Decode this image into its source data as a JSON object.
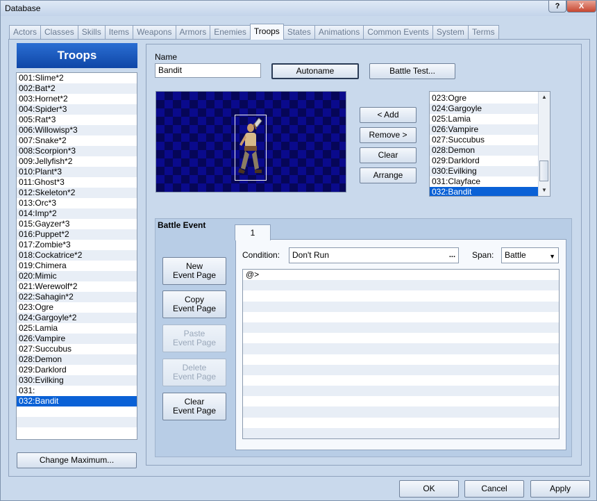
{
  "window": {
    "title": "Database",
    "help_label": "?",
    "close_label": "X"
  },
  "tabs": [
    {
      "label": "Actors"
    },
    {
      "label": "Classes"
    },
    {
      "label": "Skills"
    },
    {
      "label": "Items"
    },
    {
      "label": "Weapons"
    },
    {
      "label": "Armors"
    },
    {
      "label": "Enemies"
    },
    {
      "label": "Troops"
    },
    {
      "label": "States"
    },
    {
      "label": "Animations"
    },
    {
      "label": "Common Events"
    },
    {
      "label": "System"
    },
    {
      "label": "Terms"
    }
  ],
  "active_tab": "Troops",
  "troops": {
    "header": "Troops",
    "items": [
      "001:Slime*2",
      "002:Bat*2",
      "003:Hornet*2",
      "004:Spider*3",
      "005:Rat*3",
      "006:Willowisp*3",
      "007:Snake*2",
      "008:Scorpion*3",
      "009:Jellyfish*2",
      "010:Plant*3",
      "011:Ghost*3",
      "012:Skeleton*2",
      "013:Orc*3",
      "014:Imp*2",
      "015:Gayzer*3",
      "016:Puppet*2",
      "017:Zombie*3",
      "018:Cockatrice*2",
      "019:Chimera",
      "020:Mimic",
      "021:Werewolf*2",
      "022:Sahagin*2",
      "023:Ogre",
      "024:Gargoyle*2",
      "025:Lamia",
      "026:Vampire",
      "027:Succubus",
      "028:Demon",
      "029:Darklord",
      "030:Evilking",
      "031:",
      "032:Bandit"
    ],
    "selected": "032:Bandit",
    "change_max_label": "Change Maximum..."
  },
  "editor": {
    "name_label": "Name",
    "name_value": "Bandit",
    "autoname_label": "Autoname",
    "battle_test_label": "Battle Test...",
    "add_label": "< Add",
    "remove_label": "Remove >",
    "clear_label": "Clear",
    "arrange_label": "Arrange",
    "enemies": [
      "023:Ogre",
      "024:Gargoyle",
      "025:Lamia",
      "026:Vampire",
      "027:Succubus",
      "028:Demon",
      "029:Darklord",
      "030:Evilking",
      "031:Clayface",
      "032:Bandit"
    ],
    "enemy_selected": "032:Bandit",
    "scroll_up": "▲",
    "scroll_down": "▼"
  },
  "battle_event": {
    "title": "Battle Event",
    "page_tab": "1",
    "new_page": [
      "New",
      "Event Page"
    ],
    "copy_page": [
      "Copy",
      "Event Page"
    ],
    "paste_page": [
      "Paste",
      "Event Page"
    ],
    "delete_page": [
      "Delete",
      "Event Page"
    ],
    "clear_page": [
      "Clear",
      "Event Page"
    ],
    "condition_label": "Condition:",
    "condition_value": "Don't Run",
    "condition_button": "...",
    "span_label": "Span:",
    "span_value": "Battle",
    "commands": [
      "@>"
    ]
  },
  "footer": {
    "ok_label": "OK",
    "cancel_label": "Cancel",
    "apply_label": "Apply"
  }
}
